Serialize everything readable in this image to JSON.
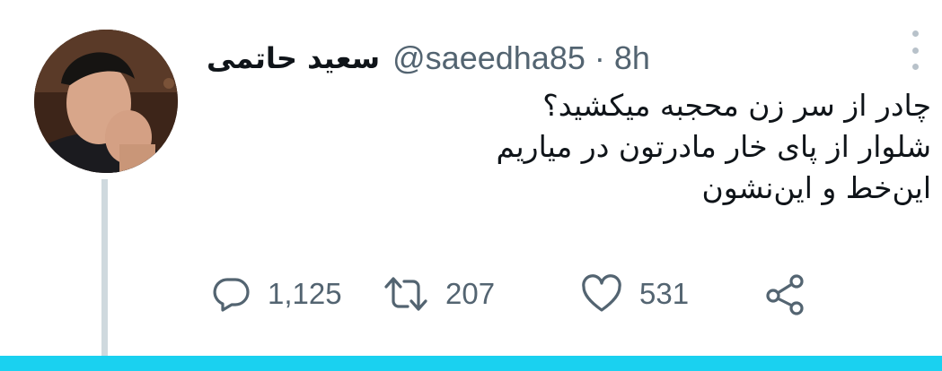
{
  "tweet": {
    "display_name": "سعید حاتمی",
    "handle": "@saeedha85",
    "separator": "·",
    "time": "8h",
    "lines": [
      "چادر از سر زن محجبه میکشید؟",
      "شلوار از پای خار مادرتون در میاریم",
      "این‌خط و این‌نشون"
    ]
  },
  "actions": {
    "reply_count": "1,125",
    "retweet_count": "207",
    "like_count": "531"
  },
  "icons": {
    "more": "more-vertical-icon",
    "reply": "reply-icon",
    "retweet": "retweet-icon",
    "like": "heart-icon",
    "share": "share-icon"
  },
  "colors": {
    "text": "#0f1419",
    "secondary": "#536471",
    "thread_line": "#cfd9de",
    "bottom_bar": "#1ad1f0"
  }
}
